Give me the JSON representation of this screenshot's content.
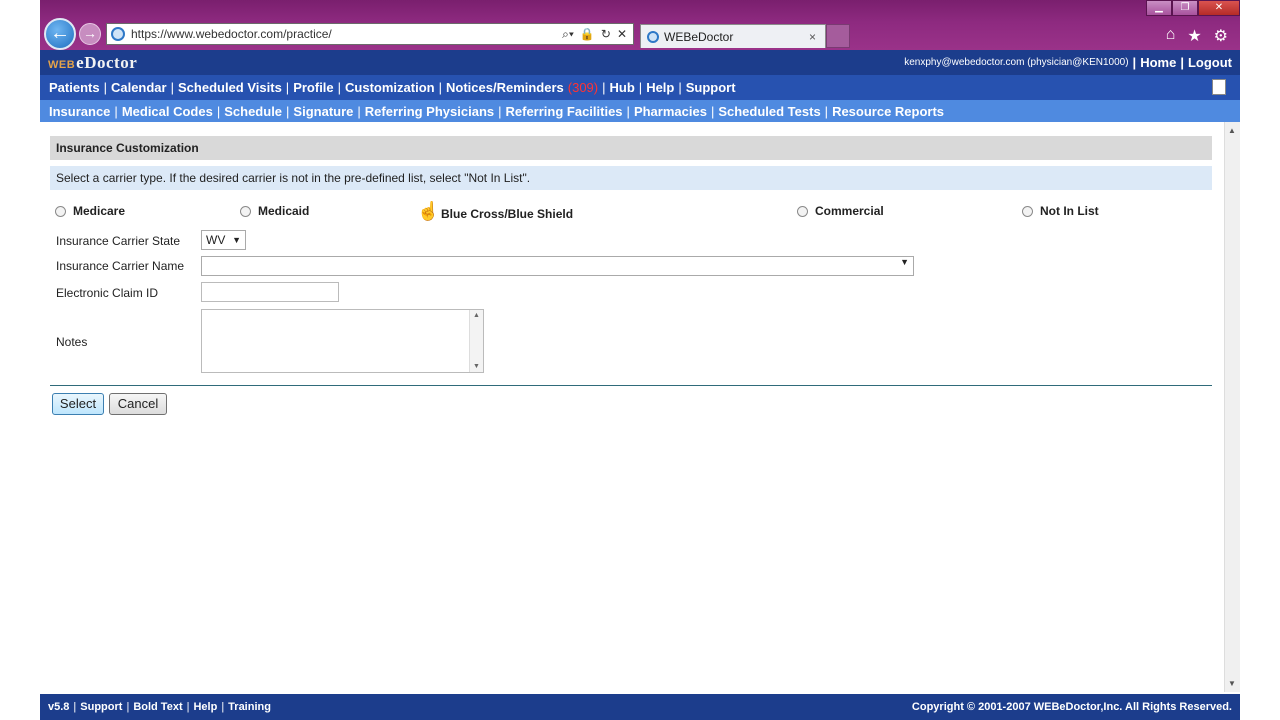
{
  "browser": {
    "url": "https://www.webedoctor.com/practice/",
    "tab_title": "WEBeDoctor",
    "window_controls": [
      "minimize",
      "restore",
      "close"
    ]
  },
  "app": {
    "logo_prefix": "WEB",
    "logo_main": "eDoctor",
    "user_info": "kenxphy@webedoctor.com (physician@KEN1000)",
    "home_label": "Home",
    "logout_label": "Logout",
    "sep": "|"
  },
  "menu1": {
    "items": [
      "Patients",
      "Calendar",
      "Scheduled Visits",
      "Profile",
      "Customization",
      "Notices/Reminders",
      "Hub",
      "Help",
      "Support"
    ],
    "notice_count": "(309)"
  },
  "menu2": {
    "items": [
      "Insurance",
      "Medical Codes",
      "Schedule",
      "Signature",
      "Referring Physicians",
      "Referring Facilities",
      "Pharmacies",
      "Scheduled Tests",
      "Resource Reports"
    ]
  },
  "form": {
    "title": "Insurance Customization",
    "hint": "Select a carrier type.  If the desired carrier is not in the pre-defined list, select \"Not In List\".",
    "carrier_types": [
      "Medicare",
      "Medicaid",
      "Blue Cross/Blue Shield",
      "Commercial",
      "Not In List"
    ],
    "state_label": "Insurance Carrier State",
    "state_value": "WV",
    "name_label": "Insurance Carrier Name",
    "name_value": "",
    "claim_label": "Electronic Claim ID",
    "claim_value": "",
    "notes_label": "Notes",
    "notes_value": "",
    "select_button": "Select",
    "cancel_button": "Cancel"
  },
  "footer": {
    "version": "v5.8",
    "links": [
      "Support",
      "Bold Text",
      "Help",
      "Training"
    ],
    "copyright": "Copyright © 2001-2007 WEBeDoctor,Inc. All Rights Reserved."
  }
}
